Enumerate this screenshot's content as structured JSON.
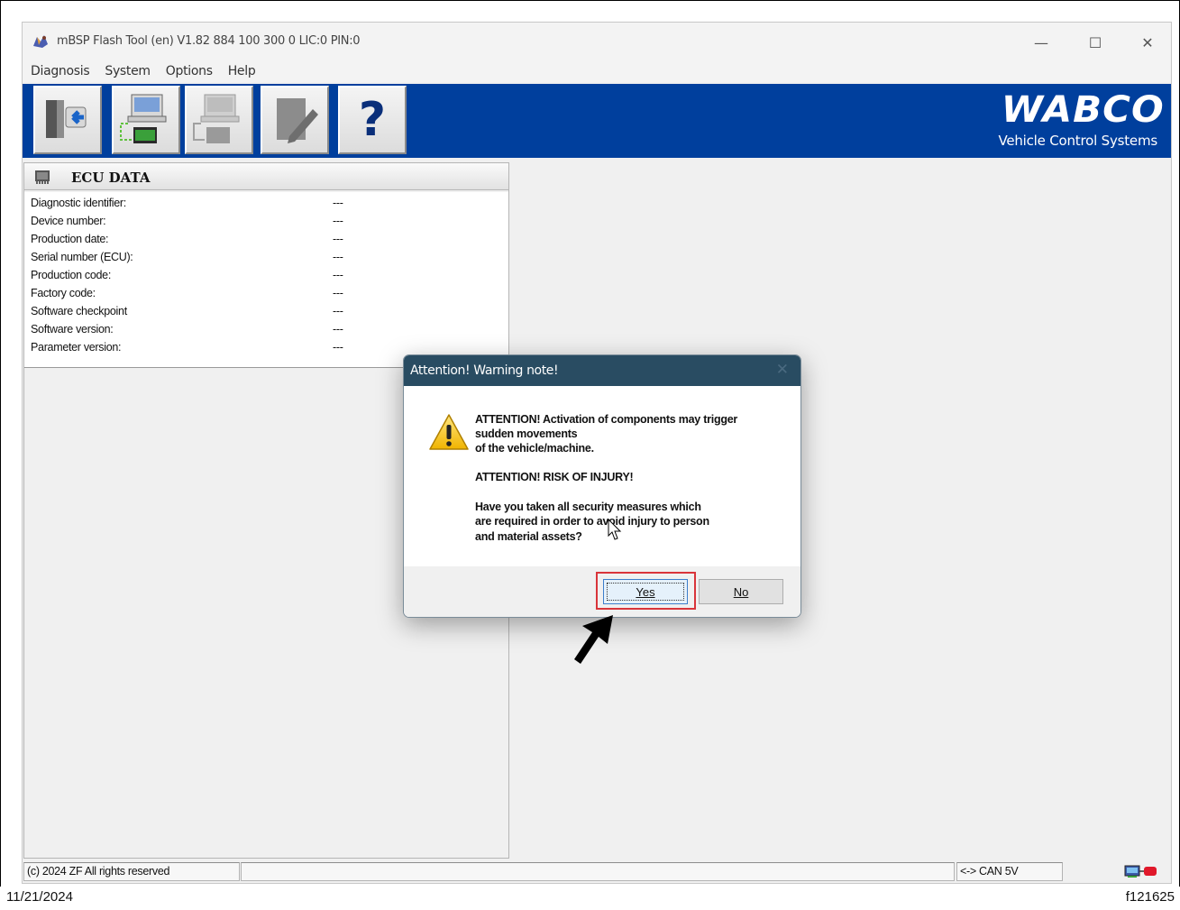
{
  "window": {
    "title": "mBSP Flash Tool (en) V1.82  884 100 300 0  LIC:0 PIN:0",
    "controls": {
      "minimize": "—",
      "maximize": "☐",
      "close": "✕"
    }
  },
  "menu": [
    "Diagnosis",
    "System",
    "Options",
    "Help"
  ],
  "toolbar": {
    "buttons": [
      {
        "icon": "exit-door-icon"
      },
      {
        "icon": "ecu-connect-icon"
      },
      {
        "icon": "ecu-disconnect-icon"
      },
      {
        "icon": "edit-icon"
      },
      {
        "icon": "help-icon",
        "glyph": "?"
      }
    ],
    "brand": "WABCO",
    "brand_subtitle": "Vehicle Control Systems",
    "color": "#003f9d"
  },
  "ecu_panel": {
    "title": "ECU DATA",
    "rows": [
      {
        "label": "Diagnostic identifier:",
        "value": "---"
      },
      {
        "label": "Device number:",
        "value": "---"
      },
      {
        "label": "Production date:",
        "value": "---"
      },
      {
        "label": "Serial number (ECU):",
        "value": "---"
      },
      {
        "label": "Production code:",
        "value": "---"
      },
      {
        "label": "Factory code:",
        "value": "---"
      },
      {
        "label": "Software checkpoint",
        "value": "---"
      },
      {
        "label": "Software version:",
        "value": "---"
      },
      {
        "label": "Parameter version:",
        "value": "---"
      }
    ]
  },
  "dialog": {
    "title": "Attention! Warning note!",
    "close": "✕",
    "icon": "warning-icon",
    "message_lines": [
      "ATTENTION! Activation of components may trigger",
      "sudden movements",
      "of the vehicle/machine.",
      "",
      "ATTENTION! RISK OF INJURY!",
      "",
      "Have you taken all security measures which",
      "are required in order to avoid injury to person",
      "and material assets?"
    ],
    "buttons": {
      "yes": "Yes",
      "no": "No"
    },
    "highlight_color": "#d9343a"
  },
  "statusbar": {
    "copyright": "(c) 2024 ZF All rights reserved",
    "middle": "",
    "connection": "<-> CAN 5V",
    "status_icon": "connection-status-icon"
  },
  "footer": {
    "date": "11/21/2024",
    "reference": "f121625"
  }
}
